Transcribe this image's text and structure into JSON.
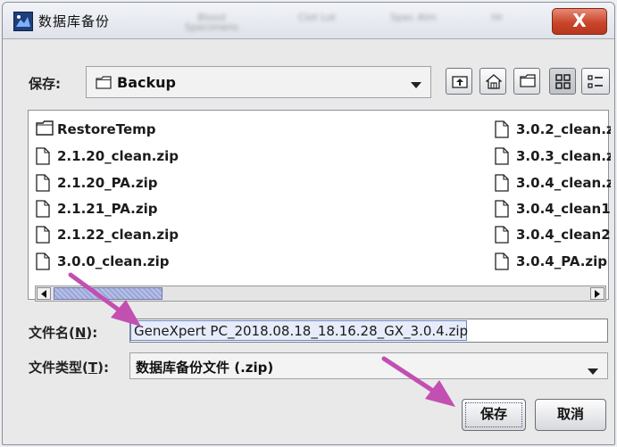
{
  "window": {
    "title": "数据库备份",
    "background_menu_blur": [
      "Blood\nSpecimens",
      "Clot\nLot",
      "Spec\nAlm",
      "Hr"
    ],
    "close_glyph": "X"
  },
  "lookin": {
    "label": "保存:",
    "folder": "Backup"
  },
  "toolbar": {
    "icons": [
      "up-folder-icon",
      "home-icon",
      "new-folder-icon",
      "list-view-icon",
      "details-view-icon"
    ]
  },
  "files": {
    "column1": [
      {
        "name": "RestoreTemp",
        "type": "folder"
      },
      {
        "name": "2.1.20_clean.zip",
        "type": "file"
      },
      {
        "name": "2.1.20_PA.zip",
        "type": "file"
      },
      {
        "name": "2.1.21_PA.zip",
        "type": "file"
      },
      {
        "name": "2.1.22_clean.zip",
        "type": "file"
      },
      {
        "name": "3.0.0_clean.zip",
        "type": "file"
      }
    ],
    "column2": [
      {
        "name": "3.0.2_clean.z",
        "type": "file"
      },
      {
        "name": "3.0.3_clean.z",
        "type": "file"
      },
      {
        "name": "3.0.4_clean.z",
        "type": "file"
      },
      {
        "name": "3.0.4_clean1.",
        "type": "file"
      },
      {
        "name": "3.0.4_clean2.",
        "type": "file"
      },
      {
        "name": "3.0.4_PA.zip",
        "type": "file"
      }
    ]
  },
  "filename": {
    "label": "文件名(N):",
    "value": "GeneXpert PC_2018.08.18_18.16.28_GX_3.0.4.zip"
  },
  "filetype": {
    "label": "文件类型(T):",
    "value": "数据库备份文件 (.zip)"
  },
  "buttons": {
    "save": "保存",
    "cancel": "取消"
  },
  "colors": {
    "annotation_arrow": "#c24fb1",
    "close_button": "#c9462c",
    "selection": "#6c86bd"
  }
}
